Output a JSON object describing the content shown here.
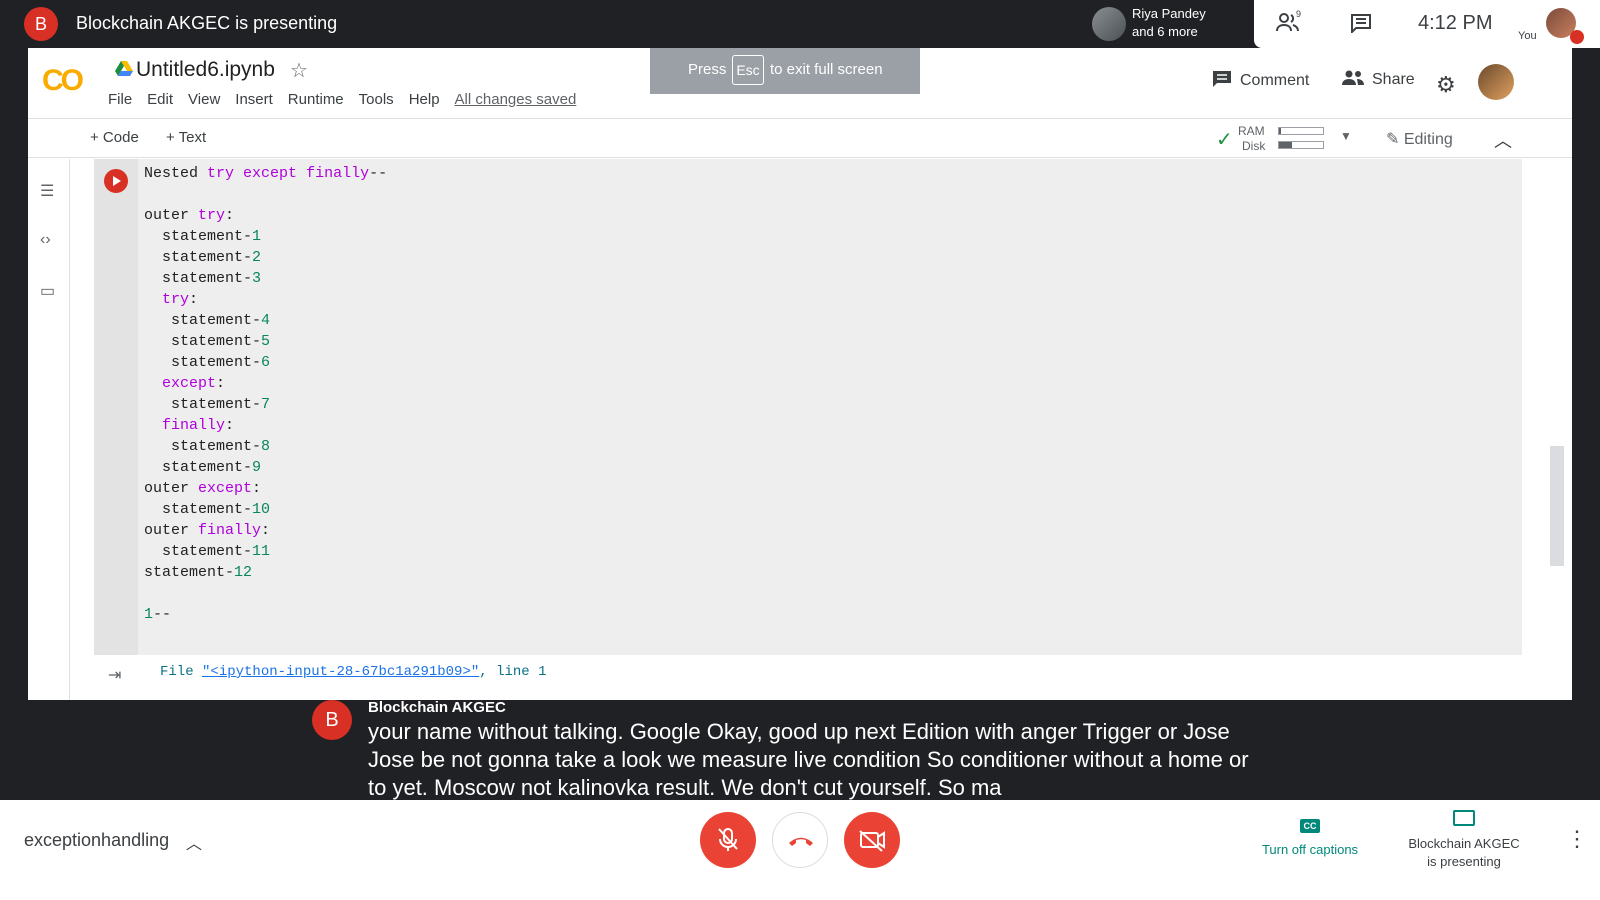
{
  "top_bar": {
    "presenter_initial": "B",
    "presenting_title": "Blockchain AKGEC is presenting",
    "participant_name": "Riya Pandey",
    "participant_more": "and 6 more",
    "people_count": "9",
    "clock": "4:12 PM",
    "you_label": "You"
  },
  "colab": {
    "logo": "CO",
    "notebook_title": "Untitled6.ipynb",
    "menu": [
      "File",
      "Edit",
      "View",
      "Insert",
      "Runtime",
      "Tools",
      "Help"
    ],
    "saved_status": "All changes saved",
    "fullscreen_hint": {
      "press": "Press",
      "key": "Esc",
      "rest": "to exit full screen"
    },
    "comment_label": "Comment",
    "share_label": "Share",
    "add_code_label": "+ Code",
    "add_text_label": "+ Text",
    "ram_label": "RAM",
    "disk_label": "Disk",
    "ram_usage": 0.05,
    "disk_usage": 0.3,
    "editing_label": "Editing",
    "output": {
      "prefix": "File ",
      "link": "\"<ipython-input-28-67bc1a291b09>\"",
      "suffix": ", line 1"
    }
  },
  "caption": {
    "initial": "B",
    "speaker": "Blockchain AKGEC",
    "text": "your name without talking. Google Okay, good up next Edition with anger Trigger or Jose Jose be not gonna take a look we measure live condition So conditioner without a home or to yet. Moscow not kalinovka result. We don't cut yourself. So ma"
  },
  "bottom_bar": {
    "meeting_name": "exceptionhandling",
    "captions_icon_text": "CC",
    "captions_label": "Turn off captions",
    "present_label_line1": "Blockchain AKGEC",
    "present_label_line2": "is presenting"
  },
  "colors": {
    "meet_red": "#ea4335",
    "teal": "#00897b",
    "colab_orange": "#f9ab00",
    "keyword_purple": "#af00db",
    "number_green": "#098658"
  }
}
